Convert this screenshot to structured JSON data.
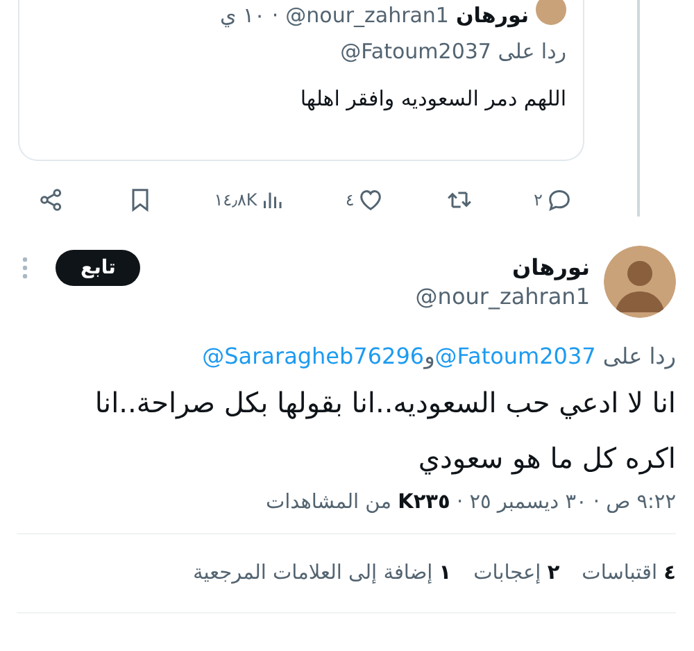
{
  "parent_tweet": {
    "name": "نورهان",
    "handle": "@nour_zahran1",
    "time": "· ١٠ ي",
    "reply_to": {
      "prefix": "ردا على",
      "mention": "@Fatoum2037"
    },
    "text": "اللهم دمر السعوديه وافقر اهلها"
  },
  "actions": [
    {
      "kind": "reply",
      "count": "٢"
    },
    {
      "kind": "repost"
    },
    {
      "kind": "like",
      "count": "٤"
    },
    {
      "kind": "views",
      "count": "١٤٫٨K"
    },
    {
      "kind": "bookmark"
    },
    {
      "kind": "share"
    }
  ],
  "tweet": {
    "name": "نورهان",
    "handle": "@nour_zahran1",
    "follow_button": "تابع",
    "reply_to": {
      "prefix": "ردا على",
      "mentions": [
        "@Fatoum2037",
        "@Sararagheb76296"
      ],
      "joiner": "و"
    },
    "text": "انا لا ادعي حب السعوديه..انا بقولها بكل صراحة..انا اكره كل ما هو سعودي",
    "meta": "٩:٢٢ ص · ٣٠ ديسمبر ٢٥ · **K٢٣٥** من المشاهدات"
  },
  "stats": [
    "**٤** اقتباسات",
    "**٢** إعجابات",
    "**١** إضافة إلى العلامات المرجعية"
  ]
}
